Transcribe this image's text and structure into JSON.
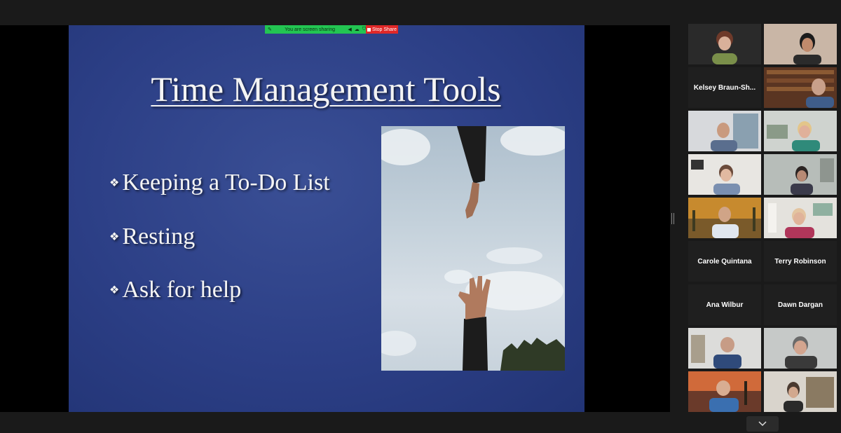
{
  "share_banner": {
    "status": "You are screen sharing",
    "stop_label": "Stop Share"
  },
  "slide": {
    "title": "Time Management Tools",
    "bullet_glyph": "❖",
    "bullets": [
      "Keeping a To-Do List",
      "Resting",
      "Ask for help"
    ]
  },
  "participants": [
    {
      "name": "",
      "type": "video"
    },
    {
      "name": "",
      "type": "video"
    },
    {
      "name": "Kelsey  Braun-Sh...",
      "type": "name"
    },
    {
      "name": "",
      "type": "video"
    },
    {
      "name": "",
      "type": "video"
    },
    {
      "name": "",
      "type": "video"
    },
    {
      "name": "",
      "type": "video"
    },
    {
      "name": "",
      "type": "video"
    },
    {
      "name": "",
      "type": "video"
    },
    {
      "name": "",
      "type": "video",
      "speaking": true
    },
    {
      "name": "Carole Quintana",
      "type": "name"
    },
    {
      "name": "Terry Robinson",
      "type": "name"
    },
    {
      "name": "Ana Wilbur",
      "type": "name"
    },
    {
      "name": "Dawn Dargan",
      "type": "name"
    },
    {
      "name": "",
      "type": "video"
    },
    {
      "name": "",
      "type": "video"
    },
    {
      "name": "",
      "type": "video"
    },
    {
      "name": "",
      "type": "video"
    }
  ],
  "colors": {
    "slide_bg": "#2c3f86",
    "share_green": "#23c552",
    "stop_red": "#e02828",
    "active_speaker": "#d8d84a"
  },
  "icons": {
    "collapse": "chevron-down-icon",
    "splitter": "panel-splitter-icon"
  }
}
